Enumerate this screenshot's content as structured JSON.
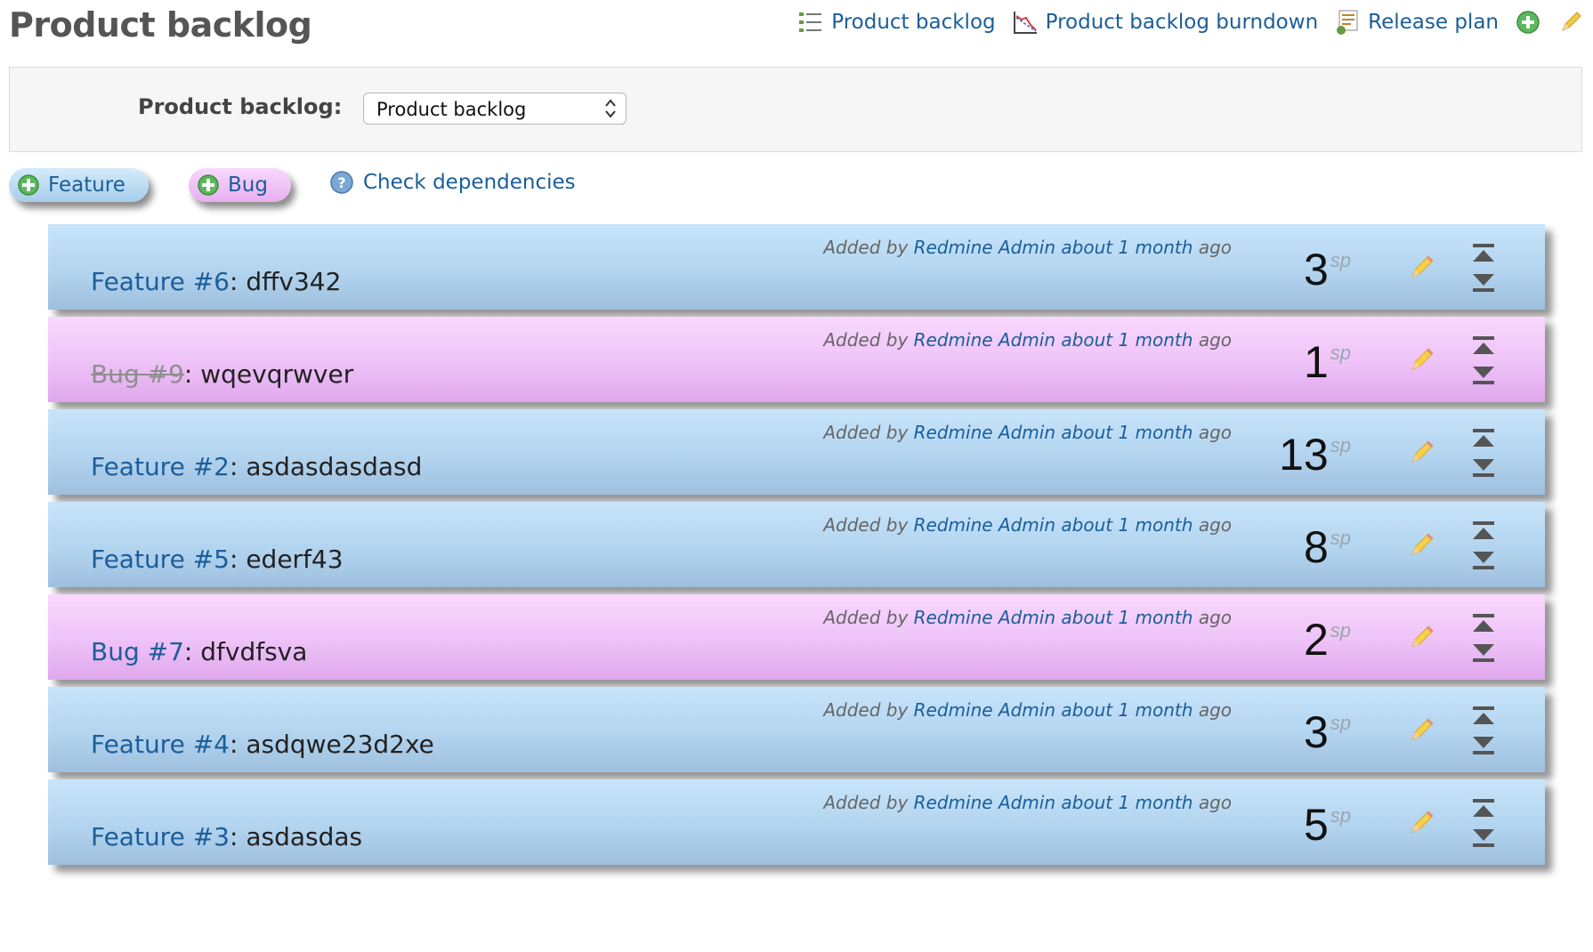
{
  "page": {
    "title": "Product backlog"
  },
  "nav": {
    "product_backlog": "Product backlog",
    "burndown": "Product backlog burndown",
    "release_plan": "Release plan"
  },
  "filter": {
    "label": "Product backlog:",
    "selected": "Product backlog"
  },
  "actions": {
    "feature": "Feature",
    "bug": "Bug",
    "check_dependencies": "Check dependencies"
  },
  "items": [
    {
      "type": "feature",
      "ref": "Feature #6",
      "separator": ":",
      "subject": "dffv342",
      "added_prefix": "Added by",
      "author": "Redmine Admin",
      "when": "about 1 month",
      "added_suffix": "ago",
      "points": "3",
      "unit": "sp",
      "closed": false
    },
    {
      "type": "bug",
      "ref": "Bug #9",
      "separator": ":",
      "subject": "wqevqrwver",
      "added_prefix": "Added by",
      "author": "Redmine Admin",
      "when": "about 1 month",
      "added_suffix": "ago",
      "points": "1",
      "unit": "sp",
      "closed": true
    },
    {
      "type": "feature",
      "ref": "Feature #2",
      "separator": ":",
      "subject": "asdasdasdasd",
      "added_prefix": "Added by",
      "author": "Redmine Admin",
      "when": "about 1 month",
      "added_suffix": "ago",
      "points": "13",
      "unit": "sp",
      "closed": false
    },
    {
      "type": "feature",
      "ref": "Feature #5",
      "separator": ":",
      "subject": "ederf43",
      "added_prefix": "Added by",
      "author": "Redmine Admin",
      "when": "about 1 month",
      "added_suffix": "ago",
      "points": "8",
      "unit": "sp",
      "closed": false
    },
    {
      "type": "bug",
      "ref": "Bug #7",
      "separator": ":",
      "subject": "dfvdfsva",
      "added_prefix": "Added by",
      "author": "Redmine Admin",
      "when": "about 1 month",
      "added_suffix": "ago",
      "points": "2",
      "unit": "sp",
      "closed": false
    },
    {
      "type": "feature",
      "ref": "Feature #4",
      "separator": ":",
      "subject": "asdqwe23d2xe",
      "added_prefix": "Added by",
      "author": "Redmine Admin",
      "when": "about 1 month",
      "added_suffix": "ago",
      "points": "3",
      "unit": "sp",
      "closed": false
    },
    {
      "type": "feature",
      "ref": "Feature #3",
      "separator": ":",
      "subject": "asdasdas",
      "added_prefix": "Added by",
      "author": "Redmine Admin",
      "when": "about 1 month",
      "added_suffix": "ago",
      "points": "5",
      "unit": "sp",
      "closed": false
    }
  ],
  "colors": {
    "link": "#1b5e9a",
    "feature_bg": "#b3d4ef",
    "bug_bg": "#eec2f8",
    "title_gray": "#555555"
  }
}
